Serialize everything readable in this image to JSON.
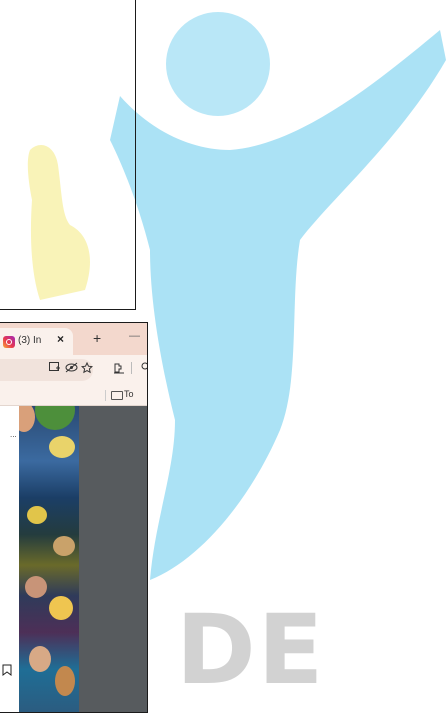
{
  "browser": {
    "tab": {
      "title": "(3) In",
      "close_label": "×",
      "icon": "instagram-icon"
    },
    "new_tab_label": "+",
    "minimize_label": "—",
    "toolbar": {
      "icons": [
        "extensions-icon",
        "hide-icon",
        "star-icon",
        "sidebar-icon"
      ]
    },
    "bookmarks": {
      "folder_label": "To"
    }
  },
  "post": {
    "more_label": "...",
    "save_icon": "bookmark-icon"
  },
  "watermark": {
    "text": "DE",
    "colors": {
      "figure": "#8fd8f2",
      "head": "#a9e2f5",
      "hand": "#f6ec98",
      "text": "#d2d2d2"
    }
  }
}
